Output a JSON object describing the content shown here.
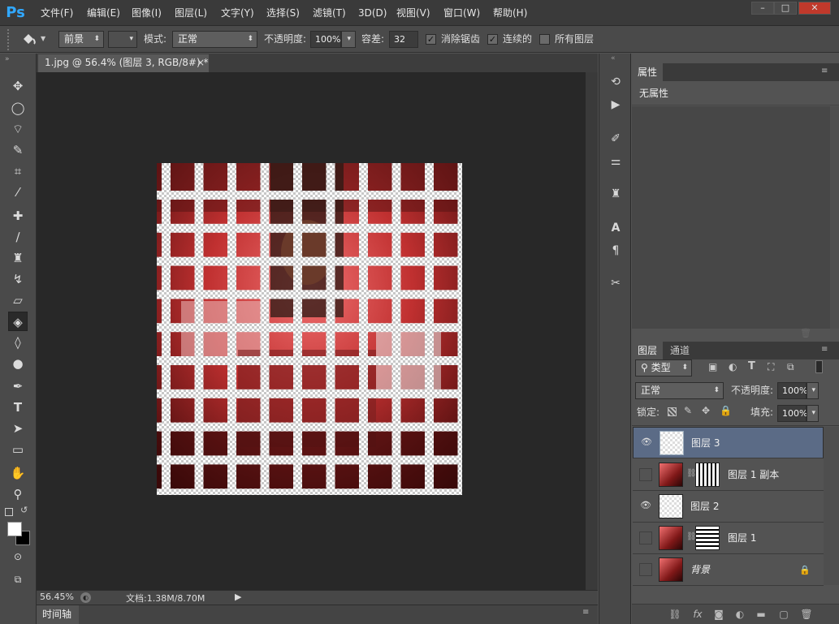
{
  "app": {
    "logo": "Ps"
  },
  "menu": [
    "文件(F)",
    "编辑(E)",
    "图像(I)",
    "图层(L)",
    "文字(Y)",
    "选择(S)",
    "滤镜(T)",
    "3D(D)",
    "视图(V)",
    "窗口(W)",
    "帮助(H)"
  ],
  "window_controls": {
    "minimize": "–",
    "restore": "□",
    "close": "✕"
  },
  "options": {
    "fill_source": "前景",
    "mode_label": "模式:",
    "mode_value": "正常",
    "opacity_label": "不透明度:",
    "opacity_value": "100%",
    "tolerance_label": "容差:",
    "tolerance_value": "32",
    "antialias_label": "消除锯齿",
    "antialias_checked": true,
    "contiguous_label": "连续的",
    "contiguous_checked": true,
    "all_layers_label": "所有图层",
    "all_layers_checked": false
  },
  "document": {
    "tab_title": "1.jpg @ 56.4% (图层 3, RGB/8#) *",
    "tab_close": "×",
    "zoom": "56.45%",
    "doc_info": "文档:1.38M/8.70M"
  },
  "timeline": {
    "label": "时间轴"
  },
  "properties": {
    "tab": "属性",
    "empty_text": "无属性"
  },
  "layers_panel": {
    "tabs": [
      "图层",
      "通道"
    ],
    "filter_kind": "类型",
    "blend_mode": "正常",
    "opacity_label": "不透明度:",
    "opacity_value": "100%",
    "lock_label": "锁定:",
    "fill_label": "填充:",
    "fill_value": "100%",
    "layers": [
      {
        "name": "图层 3",
        "visible": true,
        "selected": true,
        "mask": false
      },
      {
        "name": "图层 1 副本",
        "visible": false,
        "selected": false,
        "mask": true
      },
      {
        "name": "图层 2",
        "visible": true,
        "selected": false,
        "mask": false
      },
      {
        "name": "图层 1",
        "visible": false,
        "selected": false,
        "mask": true
      },
      {
        "name": "背景",
        "visible": false,
        "selected": false,
        "mask": false,
        "locked": true
      }
    ]
  },
  "colors": {
    "accent": "#31a8ff",
    "canvas_bg": "#282828",
    "panel_bg": "#535353",
    "selected_layer": "#5b6b86"
  }
}
